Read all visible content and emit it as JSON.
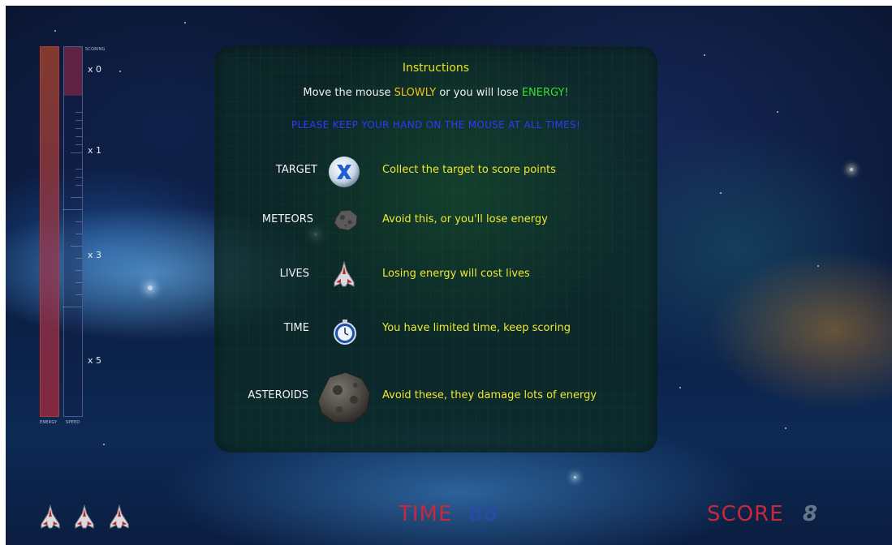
{
  "hud": {
    "scoring_caption": "SCORING",
    "energy_caption": "ENERGY",
    "speed_caption": "SPEED",
    "multipliers": [
      "x 0",
      "x 1",
      "x 3",
      "x 5"
    ],
    "lives_count": 3,
    "time_label": "TIME",
    "time_value": "88",
    "score_label": "SCORE",
    "score_value": "8"
  },
  "instructions": {
    "title": "Instructions",
    "line1_pre": "Move the mouse ",
    "line1_slowly": "SLOWLY",
    "line1_mid": " or you will lose ",
    "line1_energy": "ENERGY!",
    "warning": "PLEASE KEEP YOUR HAND ON THE MOUSE AT ALL TIMES!",
    "rows": [
      {
        "label": "TARGET",
        "icon": "target-x-icon",
        "desc": "Collect the target to score points"
      },
      {
        "label": "METEORS",
        "icon": "meteor-icon",
        "desc": "Avoid this, or you'll lose energy"
      },
      {
        "label": "LIVES",
        "icon": "spaceship-icon",
        "desc": "Losing energy will cost lives"
      },
      {
        "label": "TIME",
        "icon": "stopwatch-icon",
        "desc": "You have limited time, keep scoring"
      },
      {
        "label": "ASTEROIDS",
        "icon": "asteroid-icon",
        "desc": "Avoid these, they damage lots of energy"
      }
    ]
  },
  "colors": {
    "title": "#e4e21c",
    "highlight_slowly": "#f0c21a",
    "highlight_energy": "#37e02a",
    "warning": "#2a3bff",
    "description": "#f0e830",
    "hud_label": "#c8283a"
  }
}
